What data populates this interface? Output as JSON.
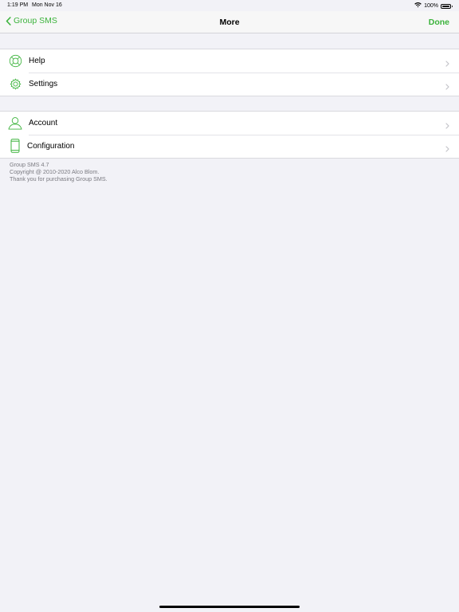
{
  "status_bar": {
    "time": "1:19 PM",
    "date": "Mon Nov 16",
    "battery_percent": "100%",
    "battery_level": 1.0,
    "wifi_icon": "wifi-icon",
    "battery_icon": "battery-icon"
  },
  "nav": {
    "back_label": "Group SMS",
    "title": "More",
    "done_label": "Done"
  },
  "colors": {
    "accent": "#3cb33c",
    "background": "#f2f2f7",
    "cell_background": "#ffffff",
    "footer_text": "#7a7a80"
  },
  "groups": [
    {
      "rows": [
        {
          "label": "Help",
          "icon": "lifebuoy-icon"
        },
        {
          "label": "Settings",
          "icon": "gear-icon"
        }
      ]
    },
    {
      "rows": [
        {
          "label": "Account",
          "icon": "person-icon"
        },
        {
          "label": "Configuration",
          "icon": "phone-icon"
        }
      ]
    }
  ],
  "footer": {
    "version": "Group SMS 4.7",
    "copyright": "Copyright @ 2010-2020 Alco Blom.",
    "thanks": "Thank you for purchasing Group SMS."
  }
}
